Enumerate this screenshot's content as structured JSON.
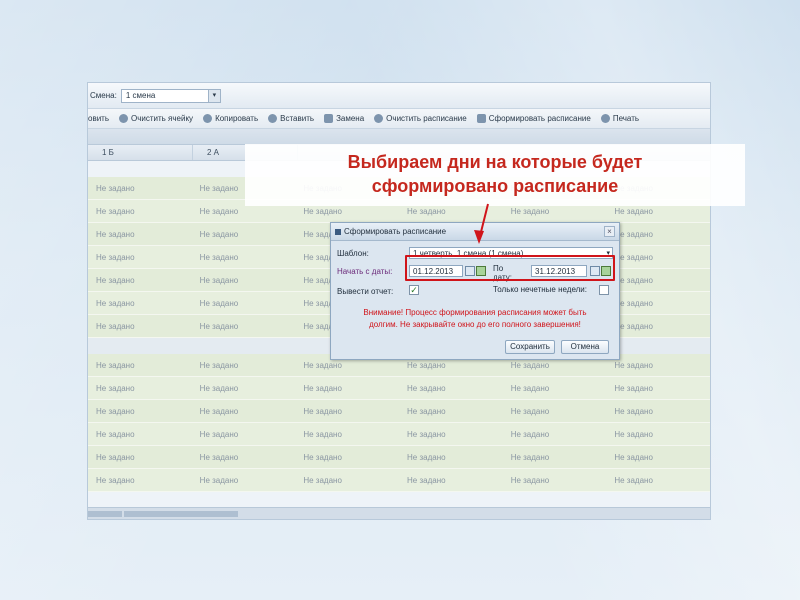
{
  "toolbar": {
    "shift_label": "Смена:",
    "shift_value": "1 смена",
    "buttons": [
      {
        "label": "овить"
      },
      {
        "label": "Очистить ячейку"
      },
      {
        "label": "Копировать"
      },
      {
        "label": "Вставить"
      },
      {
        "label": "Замена"
      },
      {
        "label": "Очистить расписание"
      },
      {
        "label": "Сформировать расписание"
      },
      {
        "label": "Печать"
      }
    ]
  },
  "grid": {
    "columns": [
      "1 Б",
      "2 А"
    ],
    "cell_placeholder": "Не задано"
  },
  "caption": {
    "line1": "Выбираем дни на которые будет",
    "line2": "сформировано расписание"
  },
  "dialog": {
    "title": "Сформировать расписание",
    "template_label": "Шаблон:",
    "template_value": "1 четверть, 1 смена (1 смена)",
    "start_label": "Начать с даты:",
    "start_value": "01.12.2013",
    "end_label": "По дату:",
    "end_value": "31.12.2013",
    "report_label": "Вывести отчет:",
    "odd_weeks_label": "Только нечетные недели:",
    "warning_line1": "Внимание! Процесс формирования расписания может быть",
    "warning_line2": "долгим. Не закрывайте окно до его полного завершения!",
    "save_label": "Сохранить",
    "cancel_label": "Отмена"
  },
  "colors": {
    "caption_red": "#c5281e",
    "warning_red": "#d0141a",
    "row_green": "#e3ecd9"
  }
}
